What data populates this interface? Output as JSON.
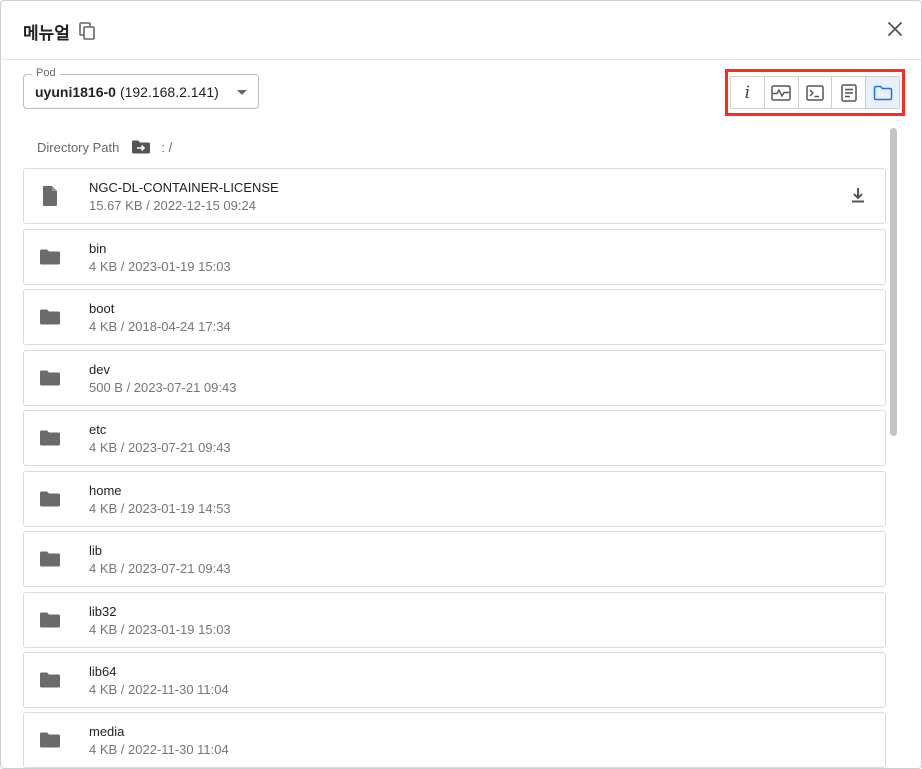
{
  "dialog": {
    "title": "메뉴얼",
    "copy_icon": "copy-icon",
    "close_icon": "close-icon"
  },
  "pod": {
    "label": "Pod",
    "name": "uyuni1816-0",
    "ip": "(192.168.2.141)"
  },
  "toolbar": {
    "highlight_color": "#ff2a1a",
    "active_color": "#1a73e8",
    "buttons": [
      {
        "icon": "info-icon",
        "glyph": "i",
        "active": false
      },
      {
        "icon": "monitoring-icon",
        "active": false
      },
      {
        "icon": "terminal-icon",
        "active": false
      },
      {
        "icon": "logs-icon",
        "active": false
      },
      {
        "icon": "folder-icon",
        "active": true
      }
    ]
  },
  "directory": {
    "label": "Directory Path",
    "icon": "folder-arrow-icon",
    "path": ": /"
  },
  "entries": [
    {
      "type": "file",
      "icon": "file-icon",
      "name": "NGC-DL-CONTAINER-LICENSE",
      "meta": "15.67 KB / 2022-12-15 09:24",
      "download_icon": "download-icon"
    },
    {
      "type": "folder",
      "icon": "folder-icon",
      "name": "bin",
      "meta": "4 KB / 2023-01-19 15:03"
    },
    {
      "type": "folder",
      "icon": "folder-icon",
      "name": "boot",
      "meta": "4 KB / 2018-04-24 17:34"
    },
    {
      "type": "folder",
      "icon": "folder-icon",
      "name": "dev",
      "meta": "500 B / 2023-07-21 09:43"
    },
    {
      "type": "folder",
      "icon": "folder-icon",
      "name": "etc",
      "meta": "4 KB / 2023-07-21 09:43"
    },
    {
      "type": "folder",
      "icon": "folder-icon",
      "name": "home",
      "meta": "4 KB / 2023-01-19 14:53"
    },
    {
      "type": "folder",
      "icon": "folder-icon",
      "name": "lib",
      "meta": "4 KB / 2023-07-21 09:43"
    },
    {
      "type": "folder",
      "icon": "folder-icon",
      "name": "lib32",
      "meta": "4 KB / 2023-01-19 15:03"
    },
    {
      "type": "folder",
      "icon": "folder-icon",
      "name": "lib64",
      "meta": "4 KB / 2022-11-30 11:04"
    },
    {
      "type": "folder",
      "icon": "folder-icon",
      "name": "media",
      "meta": "4 KB / 2022-11-30 11:04"
    }
  ]
}
